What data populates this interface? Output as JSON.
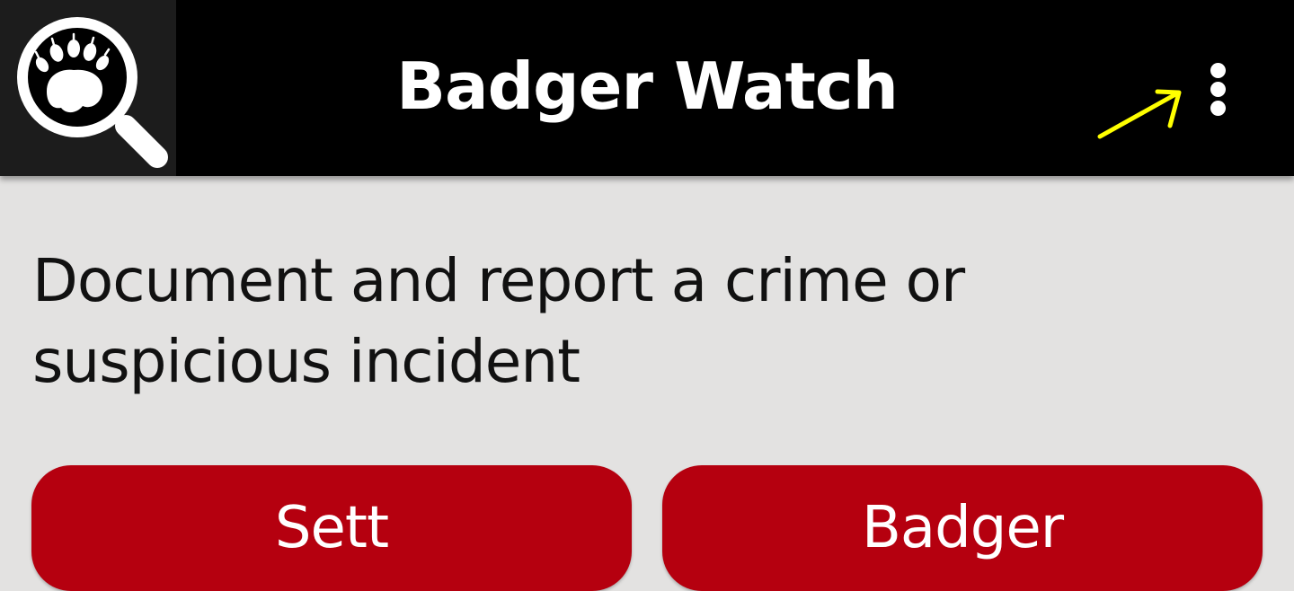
{
  "app_bar": {
    "title": "Badger Watch",
    "logo_icon": "paw-magnifier-icon",
    "menu_icon": "more-vert-icon",
    "background_color": "#000000"
  },
  "annotation": {
    "icon": "arrow-icon",
    "color": "#ffff00"
  },
  "main": {
    "intro_text": "Document and report a crime or suspicious incident",
    "background_color": "#e3e2e1",
    "buttons": [
      {
        "label": "Sett",
        "color": "#b5000f"
      },
      {
        "label": "Badger",
        "color": "#b5000f"
      }
    ]
  }
}
